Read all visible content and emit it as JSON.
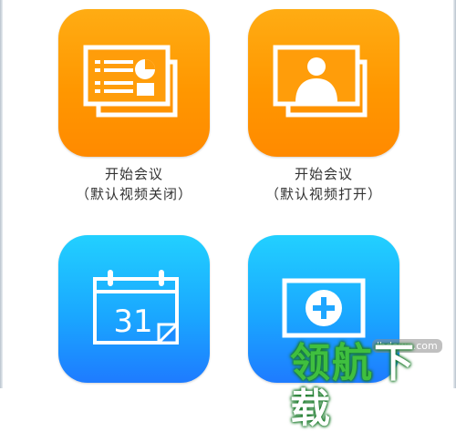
{
  "tiles": [
    {
      "id": "start-meeting-video-off",
      "label_line1": "开始会议",
      "label_line2": "（默认视频关闭）",
      "icon": "presentation-slides-icon",
      "color_top": "#ffac13",
      "color_bottom": "#ff8a00"
    },
    {
      "id": "start-meeting-video-on",
      "label_line1": "开始会议",
      "label_line2": "（默认视频打开）",
      "icon": "video-person-icon",
      "color_top": "#ffac13",
      "color_bottom": "#ff8a00"
    },
    {
      "id": "schedule-meeting",
      "icon": "calendar-icon",
      "calendar_day": "31",
      "color_top": "#22d0ff",
      "color_bottom": "#1e7bff"
    },
    {
      "id": "join-meeting",
      "icon": "add-screen-icon",
      "color_top": "#22d0ff",
      "color_bottom": "#1e7bff"
    }
  ],
  "watermark": {
    "url": "lhdown.com",
    "text_a": "领航",
    "text_b": "下载"
  }
}
